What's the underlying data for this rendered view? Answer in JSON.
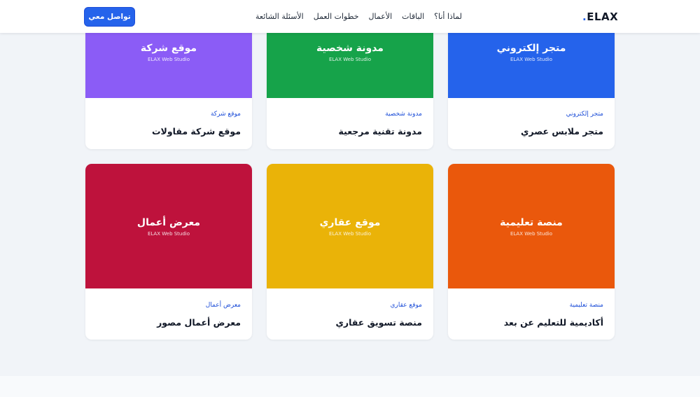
{
  "nav": {
    "logo_text": "ELAX",
    "logo_dot": ".",
    "links": [
      "لماذا أنا؟",
      "الباقات",
      "الأعمال",
      "خطوات العمل",
      "الأسئلة الشائعة"
    ],
    "cta_label": "تواصل معي"
  },
  "studio_name": "ELAX Web Studio",
  "colors": {
    "accent": "#2563eb",
    "purple": "#8b5cf6",
    "green": "#16a34a",
    "blue": "#2563eb",
    "crimson": "#be123c",
    "amber": "#eab308",
    "orange": "#ea580c"
  },
  "cards": [
    {
      "thumb_title": "متجر إلكتروني",
      "tag": "متجر إلكتروني",
      "title": "متجر ملابس عصري"
    },
    {
      "thumb_title": "مدونة شخصية",
      "tag": "مدونة شخصية",
      "title": "مدونة تقنية مرجعية"
    },
    {
      "thumb_title": "موقع شركة",
      "tag": "موقع شركة",
      "title": "موقع شركة مقاولات"
    },
    {
      "thumb_title": "منصة تعليمية",
      "tag": "منصة تعليمية",
      "title": "أكاديمية للتعليم عن بعد"
    },
    {
      "thumb_title": "موقع عقاري",
      "tag": "موقع عقاري",
      "title": "منصة تسويق عقاري"
    },
    {
      "thumb_title": "معرض أعمال",
      "tag": "معرض أعمال",
      "title": "معرض أعمال مصور"
    }
  ]
}
